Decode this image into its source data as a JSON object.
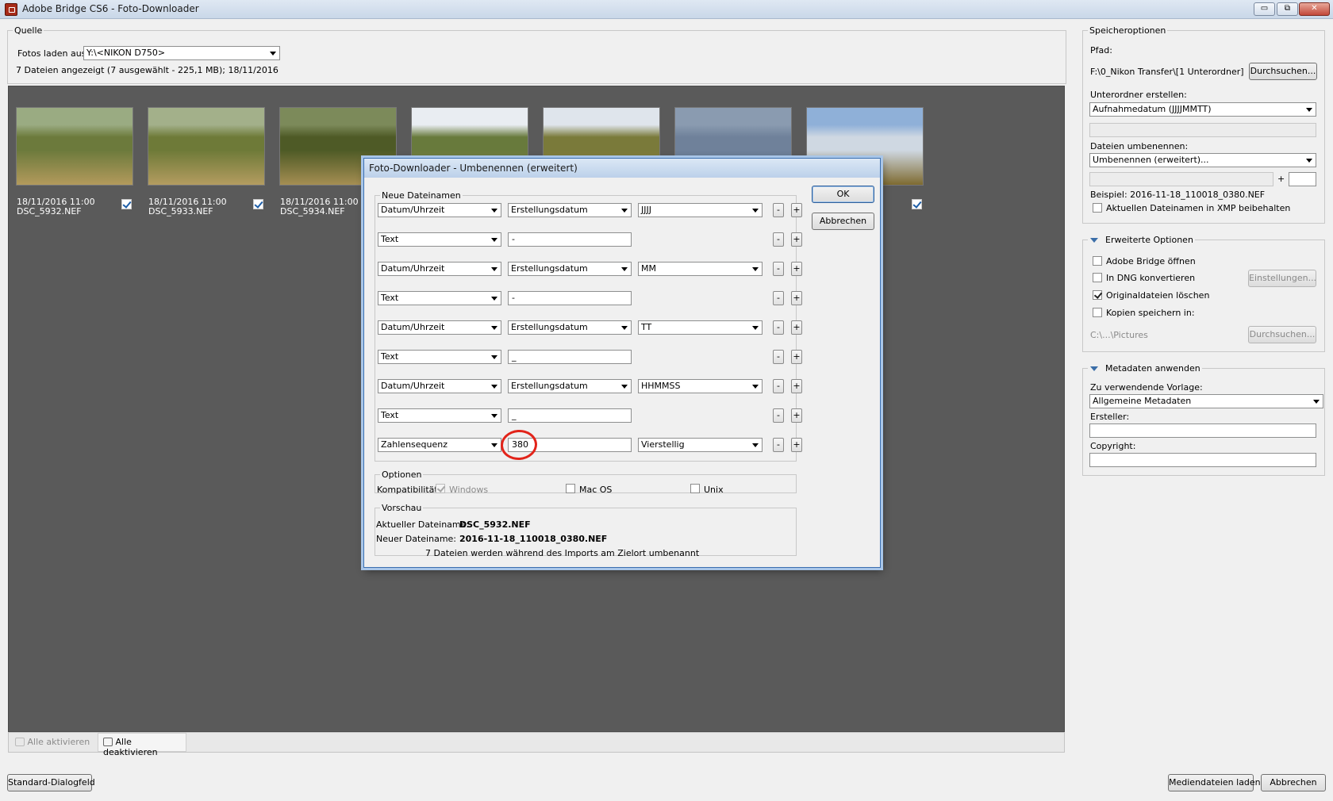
{
  "window": {
    "title": "Adobe Bridge CS6 - Foto-Downloader",
    "buttons": [
      "▭",
      "⧉",
      "✕"
    ]
  },
  "source": {
    "legend": "Quelle",
    "load_label": "Fotos laden aus:",
    "load_value": "Y:\\<NIKON D750>",
    "status": "7 Dateien angezeigt (7 ausgewählt - 225,1 MB); 18/11/2016"
  },
  "thumbnails": [
    {
      "date": "18/11/2016 11:00",
      "file": "DSC_5932.NEF",
      "colors": [
        "#9aab82",
        "#6c7a3c",
        "#b39a5c"
      ]
    },
    {
      "date": "18/11/2016 11:00",
      "file": "DSC_5933.NEF",
      "colors": [
        "#a3b08a",
        "#6e7a38",
        "#b49c60"
      ]
    },
    {
      "date": "18/11/2016 11:00",
      "file": "DSC_5934.NEF",
      "colors": [
        "#7c8a5a",
        "#4e5a26",
        "#a58e52"
      ]
    },
    {
      "colors": [
        "#e9edf2",
        "#687a3c",
        "#9a8a5a"
      ]
    },
    {
      "colors": [
        "#dfe5ec",
        "#7a7a3a",
        "#a38e4c"
      ]
    },
    {
      "colors": [
        "#8a9bb0",
        "#6f819a",
        "#5e6f86"
      ]
    },
    {
      "colors": [
        "#8fb0d8",
        "#cfd8e2",
        "#7e6a30"
      ]
    }
  ],
  "grid_footer": {
    "activate_all": "Alle aktivieren",
    "deactivate_all": "Alle deaktivieren"
  },
  "bottom": {
    "standard_dialog": "Standard-Dialogfeld",
    "load_media": "Mediendateien laden",
    "cancel": "Abbrechen"
  },
  "storage": {
    "legend": "Speicheroptionen",
    "path_label": "Pfad:",
    "path_value": "F:\\0_Nikon Transfer\\[1 Unterordner]",
    "browse": "Durchsuchen...",
    "subfolder_label": "Unterordner erstellen:",
    "subfolder_value": "Aufnahmedatum (JJJJMMTT)",
    "rename_label": "Dateien umbenennen:",
    "rename_value": "Umbenennen (erweitert)...",
    "plus": "+",
    "example": "Beispiel: 2016-11-18_110018_0380.NEF",
    "keep_name": "Aktuellen Dateinamen in XMP beibehalten"
  },
  "advanced": {
    "legend": "Erweiterte Optionen",
    "open_bridge": "Adobe Bridge öffnen",
    "convert_dng": "In DNG konvertieren",
    "settings": "Einstellungen...",
    "delete_originals": "Originaldateien löschen",
    "save_copies": "Kopien speichern in:",
    "copies_path": "C:\\...\\Pictures",
    "browse": "Durchsuchen..."
  },
  "metadata": {
    "legend": "Metadaten anwenden",
    "template_label": "Zu verwendende Vorlage:",
    "template_value": "Allgemeine Metadaten",
    "creator_label": "Ersteller:",
    "copyright_label": "Copyright:"
  },
  "dialog": {
    "title": "Foto-Downloader - Umbenennen (erweitert)",
    "ok": "OK",
    "cancel": "Abbrechen",
    "names_legend": "Neue Dateinamen",
    "minus": "-",
    "plus": "+",
    "rows": [
      {
        "type": "Datum/Uhrzeit",
        "source": "Erstellungsdatum",
        "format": "JJJJ"
      },
      {
        "type": "Text",
        "text": "-"
      },
      {
        "type": "Datum/Uhrzeit",
        "source": "Erstellungsdatum",
        "format": "MM"
      },
      {
        "type": "Text",
        "text": "-"
      },
      {
        "type": "Datum/Uhrzeit",
        "source": "Erstellungsdatum",
        "format": "TT"
      },
      {
        "type": "Text",
        "text": "_"
      },
      {
        "type": "Datum/Uhrzeit",
        "source": "Erstellungsdatum",
        "format": "HHMMSS"
      },
      {
        "type": "Text",
        "text": "_"
      },
      {
        "type": "Zahlensequenz",
        "text": "380",
        "format": "Vierstellig"
      }
    ],
    "options_legend": "Optionen",
    "compat_label": "Kompatibilität:",
    "windows": "Windows",
    "macos": "Mac OS",
    "unix": "Unix",
    "preview_legend": "Vorschau",
    "current_label": "Aktueller Dateiname:",
    "current_value": "DSC_5932.NEF",
    "new_label": "Neuer Dateiname:",
    "new_value": "2016-11-18_110018_0380.NEF",
    "summary": "7 Dateien werden während des Imports am Zielort umbenannt"
  },
  "colors": {
    "grid_bg": "#5a5a5a",
    "highlight": "#e2241a",
    "dialog_border": "#3b6fb0"
  }
}
